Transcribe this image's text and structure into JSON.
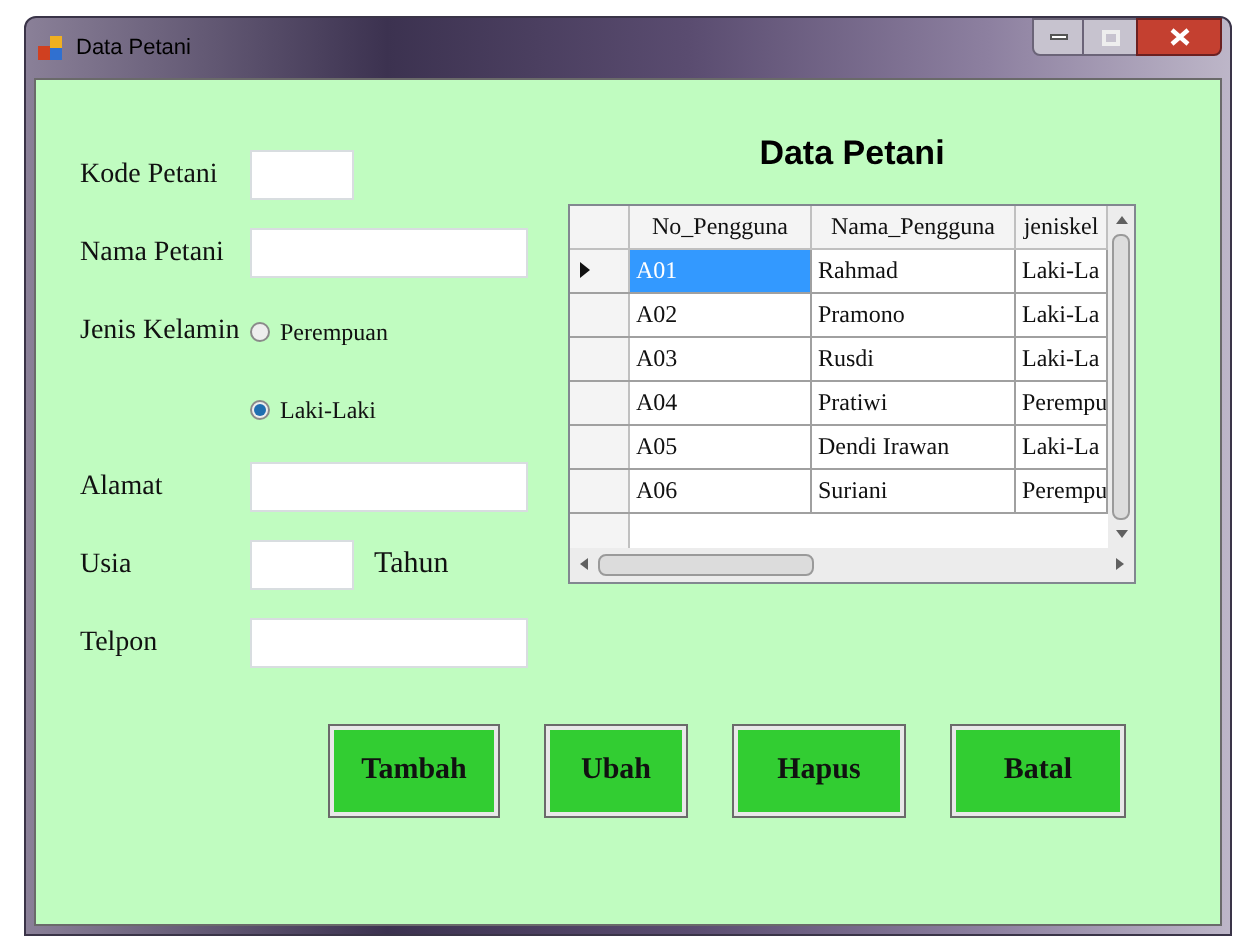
{
  "window": {
    "title": "Data Petani"
  },
  "form": [
    {
      "kind": "short",
      "label": "Kode Petani"
    },
    {
      "kind": "long",
      "label": "Nama Petani"
    },
    {
      "kind": "radio",
      "label": "Jenis Kelamin",
      "options": [
        {
          "label": "Perempuan",
          "selected": false
        },
        {
          "label": "Laki-Laki",
          "selected": true
        }
      ]
    },
    {
      "kind": "long",
      "label": "Alamat"
    },
    {
      "kind": "short",
      "label": "Usia",
      "suffix": "Tahun"
    },
    {
      "kind": "long",
      "label": "Telpon"
    }
  ],
  "grid_title": "Data Petani",
  "table": {
    "columns": [
      "No_Pengguna",
      "Nama_Pengguna",
      "jeniskel"
    ],
    "rows": [
      {
        "selected": true,
        "cells": [
          "A01",
          "Rahmad",
          "Laki-La"
        ]
      },
      {
        "selected": false,
        "cells": [
          "A02",
          "Pramono",
          "Laki-La"
        ]
      },
      {
        "selected": false,
        "cells": [
          "A03",
          "Rusdi",
          "Laki-La"
        ]
      },
      {
        "selected": false,
        "cells": [
          "A04",
          "Pratiwi",
          "Perempu"
        ]
      },
      {
        "selected": false,
        "cells": [
          "A05",
          "Dendi Irawan",
          "Laki-La"
        ]
      },
      {
        "selected": false,
        "cells": [
          "A06",
          "Suriani",
          "Perempu"
        ]
      }
    ]
  },
  "buttons": [
    "Tambah",
    "Ubah",
    "Hapus",
    "Batal"
  ]
}
